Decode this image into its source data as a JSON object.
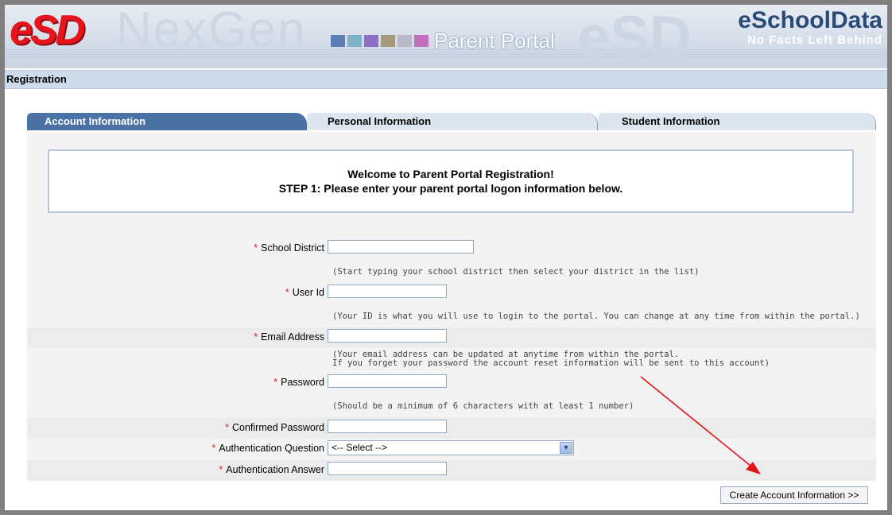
{
  "banner": {
    "ghost_text": "NexGen",
    "portal_title": "Parent Portal",
    "brand_name": "eSchoolData",
    "brand_tagline": "No Facts Left Behind",
    "logo_text": "eSD",
    "square_colors": [
      "#5b7fb4",
      "#7fb3c9",
      "#8f6fc4",
      "#a79a7a",
      "#b9b9c9",
      "#c46fbd"
    ]
  },
  "page": {
    "section_title": "Registration"
  },
  "tabs": [
    {
      "label": "Account Information"
    },
    {
      "label": "Personal Information"
    },
    {
      "label": "Student Information"
    }
  ],
  "welcome": {
    "line1": "Welcome to Parent Portal Registration!",
    "line2": "STEP 1: Please enter your parent portal logon information below."
  },
  "form": {
    "required_mark": "*",
    "school_district": {
      "label": "School District",
      "value": "",
      "hint": "(Start typing your school district then select your district in the list)"
    },
    "user_id": {
      "label": "User Id",
      "value": "",
      "hint": "(Your ID is what you will use to login to the portal. You can change at any time from within the portal.)"
    },
    "email": {
      "label": "Email Address",
      "value": "",
      "hint_line1": "(Your email address can be updated at anytime from within the portal.",
      "hint_line2": "If you forget your password the account reset information will be sent to this account)"
    },
    "password": {
      "label": "Password",
      "value": "",
      "hint": "(Should be a minimum of 6 characters with at least 1 number)"
    },
    "confirm_password": {
      "label": "Confirmed Password",
      "value": ""
    },
    "auth_question": {
      "label": "Authentication Question",
      "selected": "<-- Select -->"
    },
    "auth_answer": {
      "label": "Authentication Answer",
      "value": ""
    }
  },
  "submit": {
    "label": "Create Account Information >>"
  },
  "colors": {
    "accent": "#4b72a4",
    "required": "#d0262a",
    "annotation_arrow": "#e0141b"
  }
}
